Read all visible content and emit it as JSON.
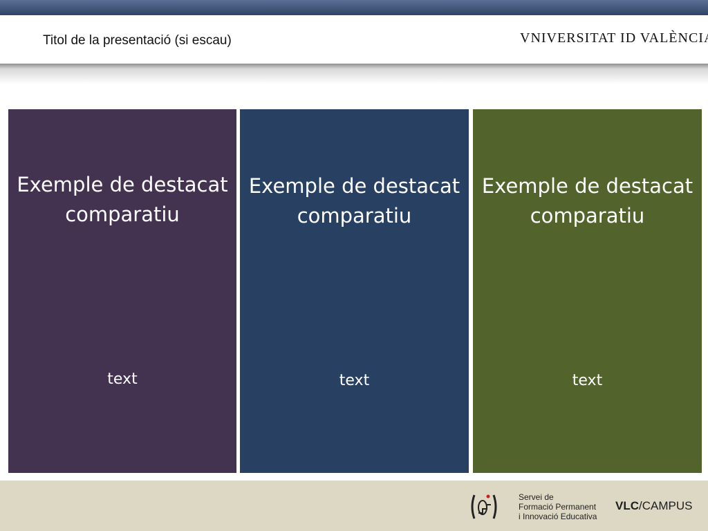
{
  "slide": {
    "title": "Titol de la presentació (si escau)",
    "university_logo_text": "VNIVERSITAT ID VALÈNCIA"
  },
  "panels": [
    {
      "heading": "Exemple de destacat comparatiu",
      "text": "text",
      "color": "#433250"
    },
    {
      "heading": "Exemple de destacat comparatiu",
      "text": "text",
      "color": "#284062"
    },
    {
      "heading": "Exemple de destacat comparatiu",
      "text": "text",
      "color": "#52632b"
    }
  ],
  "footer": {
    "service_lines": [
      "Servei de",
      "Formació Permanent",
      "i Innovació Educativa"
    ],
    "campus_logo_bold": "VLC",
    "campus_logo_rest": "/CAMPUS"
  },
  "colors": {
    "top_bar": "#2f4466",
    "footer_bg": "#dcd8c4"
  }
}
